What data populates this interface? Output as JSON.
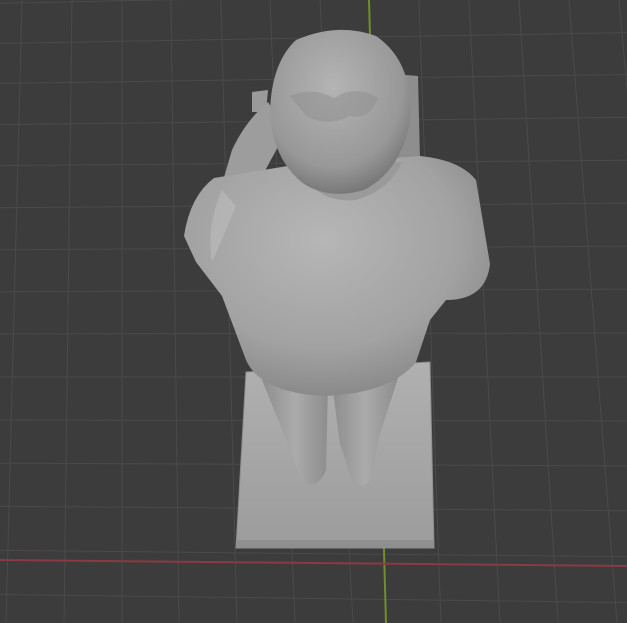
{
  "viewport": {
    "background_color": "#3c3c3c",
    "grid_line_color": "#4a4a4a",
    "x_axis_color": "#8a3a44",
    "y_axis_color": "#6f8f2a",
    "model_color": "#a8a8a8",
    "model": "figure-statue"
  }
}
